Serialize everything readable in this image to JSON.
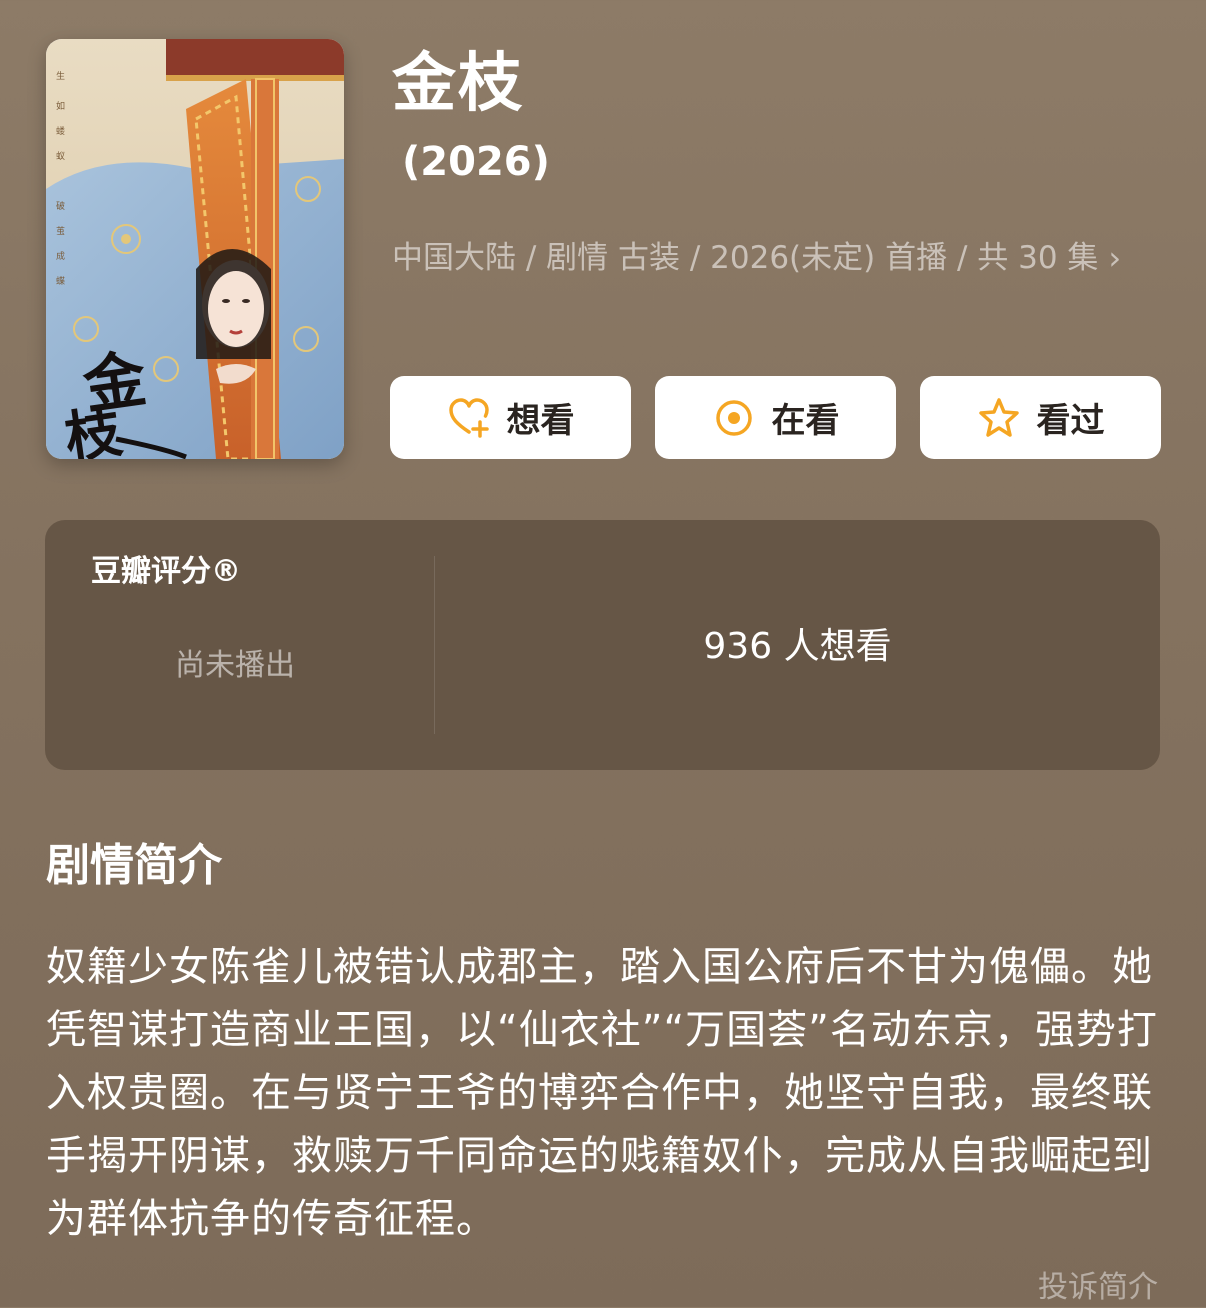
{
  "poster": {
    "title_art": "金枝"
  },
  "header": {
    "title": "金枝",
    "year": "(2026)",
    "meta": "中国大陆 / 剧情 古装 / 2026(未定) 首播 / 共 30 集"
  },
  "actions": {
    "want_label": "想看",
    "watching_label": "在看",
    "watched_label": "看过"
  },
  "rating": {
    "label": "豆瓣评分®",
    "status": "尚未播出",
    "wish_count": "936 人想看"
  },
  "synopsis": {
    "title": "剧情简介",
    "text": "奴籍少女陈雀儿被错认成郡主，踏入国公府后不甘为傀儡。她凭智谋打造商业王国，以“仙衣社”“万国荟”名动东京，强势打入权贵圈。在与贤宁王爷的博弈合作中，她坚守自我，最终联手揭开阴谋，救赎万千同命运的贱籍奴仆，完成从自我崛起到为群体抗争的传奇征程。",
    "report_label": "投诉简介"
  },
  "colors": {
    "background": "#857360",
    "panel": "#665646",
    "accent": "#f5a623",
    "button_bg": "#ffffff"
  },
  "icons": {
    "want": "heart-plus-icon",
    "watching": "dot-circle-icon",
    "watched": "star-icon",
    "meta_more": "chevron-right-icon"
  }
}
